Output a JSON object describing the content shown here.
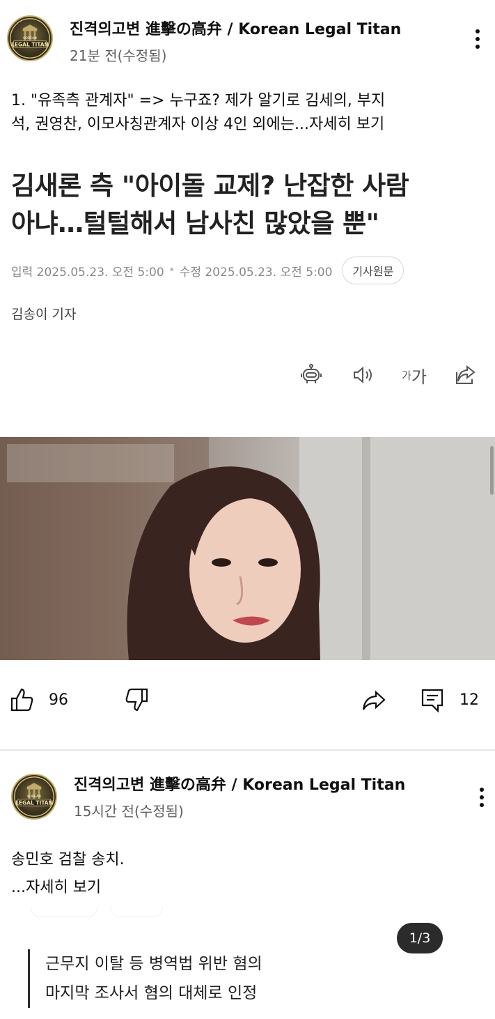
{
  "posts": [
    {
      "channel_name": "진격의고변 進擊の高弁 / Korean Legal Titan",
      "time": "21분 전(수정됨)",
      "text_line1": "1. \"유족측 관계자\" => 누구죠? 제가 알기로 김세의, 부지",
      "text_line2": "석, 권영찬, 이모사칭관계자 이상 4인 외에는",
      "more_label": "...자세히 보기"
    },
    {
      "channel_name": "진격의고변 進擊の高弁 / Korean Legal Titan",
      "time": "15시간 전(수정됨)",
      "text_line1": "송민호 검찰 송치.",
      "more_label": "...자세히 보기"
    }
  ],
  "avatar_logo": {
    "top": "KOREAN",
    "main": "LEGAL TITAN"
  },
  "article": {
    "headline_line1": "김새론 측 \"아이돌 교제? 난잡한 사람",
    "headline_line2": "아냐…털털해서 남사친 많았을 뿐\"",
    "input_date": "입력 2025.05.23. 오전 5:00",
    "edit_date": "수정 2025.05.23. 오전 5:00",
    "origin_button": "기사원문",
    "reporter": "김송이 기자",
    "tools": {
      "summary_icon": "robot-icon",
      "audio_icon": "speaker-icon",
      "font_small": "가",
      "font_large": "가",
      "share_icon": "share-icon"
    }
  },
  "actions": {
    "like_count": "96",
    "comment_count": "12",
    "icons": [
      "thumb-up-icon",
      "thumb-down-icon",
      "share-arrow-icon",
      "comment-icon"
    ]
  },
  "image_pager": "1/3",
  "quote_lines": [
    "근무지 이탈 등 병역법 위반 혐의",
    "마지막 조사서 혐의 대체로 인정"
  ],
  "colors": {
    "text": "#0f0f0f",
    "muted": "#606060",
    "divider": "#e5e5e5",
    "pager_bg": "#2b2b2b"
  }
}
